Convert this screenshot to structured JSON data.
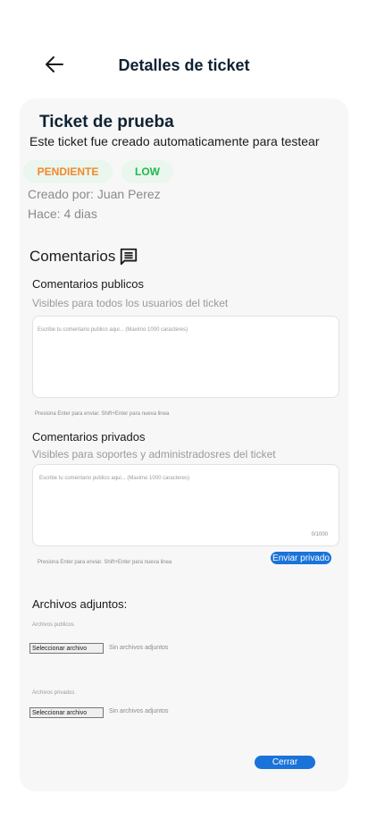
{
  "header": {
    "back_icon": "arrow-left-icon",
    "title": "Detalles de ticket"
  },
  "ticket": {
    "title": "Ticket de prueba",
    "description": "Este ticket fue creado automaticamente para testear",
    "status": "PENDIENTE",
    "priority": "LOW",
    "created_by": "Creado por: Juan Perez",
    "ago": "Hace: 4 dias"
  },
  "comments": {
    "heading": "Comentarios",
    "heading_icon": "comment-icon",
    "public": {
      "title": "Comentarios publicos",
      "subtitle": "Visibles para todos los usuarios del ticket",
      "placeholder": "Escribe tu comentario publico aqui... (Maximo 1000 caracteres)",
      "hint": "Presiona Enter para enviar. Shift+Enter para nueva linea"
    },
    "private": {
      "title": "Comentarios privados",
      "subtitle": "Visibles para soportes y administradosres del ticket",
      "placeholder": "Escribe tu comentario publico aqui... (Maximo 1000 caracteres)",
      "counter": "0/1000",
      "hint": "Presiona Enter para enviar. Shift+Enter para nueva linea",
      "send_label": "Enviar privado"
    }
  },
  "attachments": {
    "heading": "Archivos adjuntos:",
    "public_label": "Archivos publicos",
    "private_label": "Archivos privados",
    "select_label": "Seleccionar archivo",
    "none_label": "Sin archivos adjuntos"
  },
  "footer": {
    "close_label": "Cerrar"
  },
  "colors": {
    "accent": "#1a73d9",
    "status_pending": "#f0892b",
    "priority_low": "#1eb94d",
    "card_bg": "#f7f7f7"
  }
}
